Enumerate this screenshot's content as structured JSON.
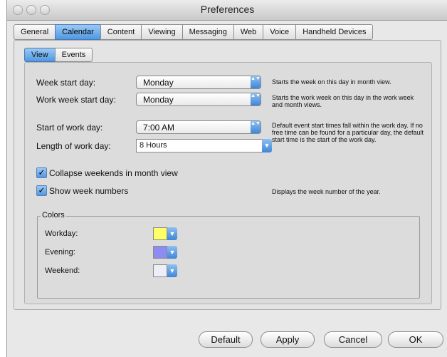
{
  "window": {
    "title": "Preferences"
  },
  "top_tabs": [
    {
      "label": "General"
    },
    {
      "label": "Calendar"
    },
    {
      "label": "Content"
    },
    {
      "label": "Viewing"
    },
    {
      "label": "Messaging"
    },
    {
      "label": "Web"
    },
    {
      "label": "Voice"
    },
    {
      "label": "Handheld Devices"
    }
  ],
  "active_top_tab": "Calendar",
  "sub_tabs": [
    {
      "label": "View"
    },
    {
      "label": "Events"
    }
  ],
  "active_sub_tab": "View",
  "settings": {
    "week_start": {
      "label": "Week start day:",
      "value": "Monday",
      "help": "Starts the week on this day in month view."
    },
    "work_week_start": {
      "label": "Work week start day:",
      "value": "Monday",
      "help": "Starts the work week on this day in the work week and month views."
    },
    "start_work_day": {
      "label": "Start of work day:",
      "value": "7:00 AM",
      "help": "Default event start times fall within the work day.  If no free time can be found for a particular day, the default start time is the start of the work day."
    },
    "length_work_day": {
      "label": "Length of work day:",
      "value": "8 Hours"
    },
    "collapse_weekends": {
      "label": "Collapse weekends in month view",
      "checked": true
    },
    "show_week_numbers": {
      "label": "Show week numbers",
      "checked": true,
      "help": "Displays the week number of the year."
    }
  },
  "colors": {
    "legend": "Colors",
    "workday": {
      "label": "Workday:",
      "color": "#ffff66"
    },
    "evening": {
      "label": "Evening:",
      "color": "#8c8cf2"
    },
    "weekend": {
      "label": "Weekend:",
      "color": "#eeeef6"
    }
  },
  "buttons": {
    "default": "Default",
    "apply": "Apply",
    "cancel": "Cancel",
    "ok": "OK"
  },
  "glyphs": {
    "check": "✓",
    "popup_arrows": "▲▼",
    "down_arrow": "▼"
  },
  "theme": {
    "accent": "#4f97e3",
    "window_bg": "#e8e8e8"
  }
}
